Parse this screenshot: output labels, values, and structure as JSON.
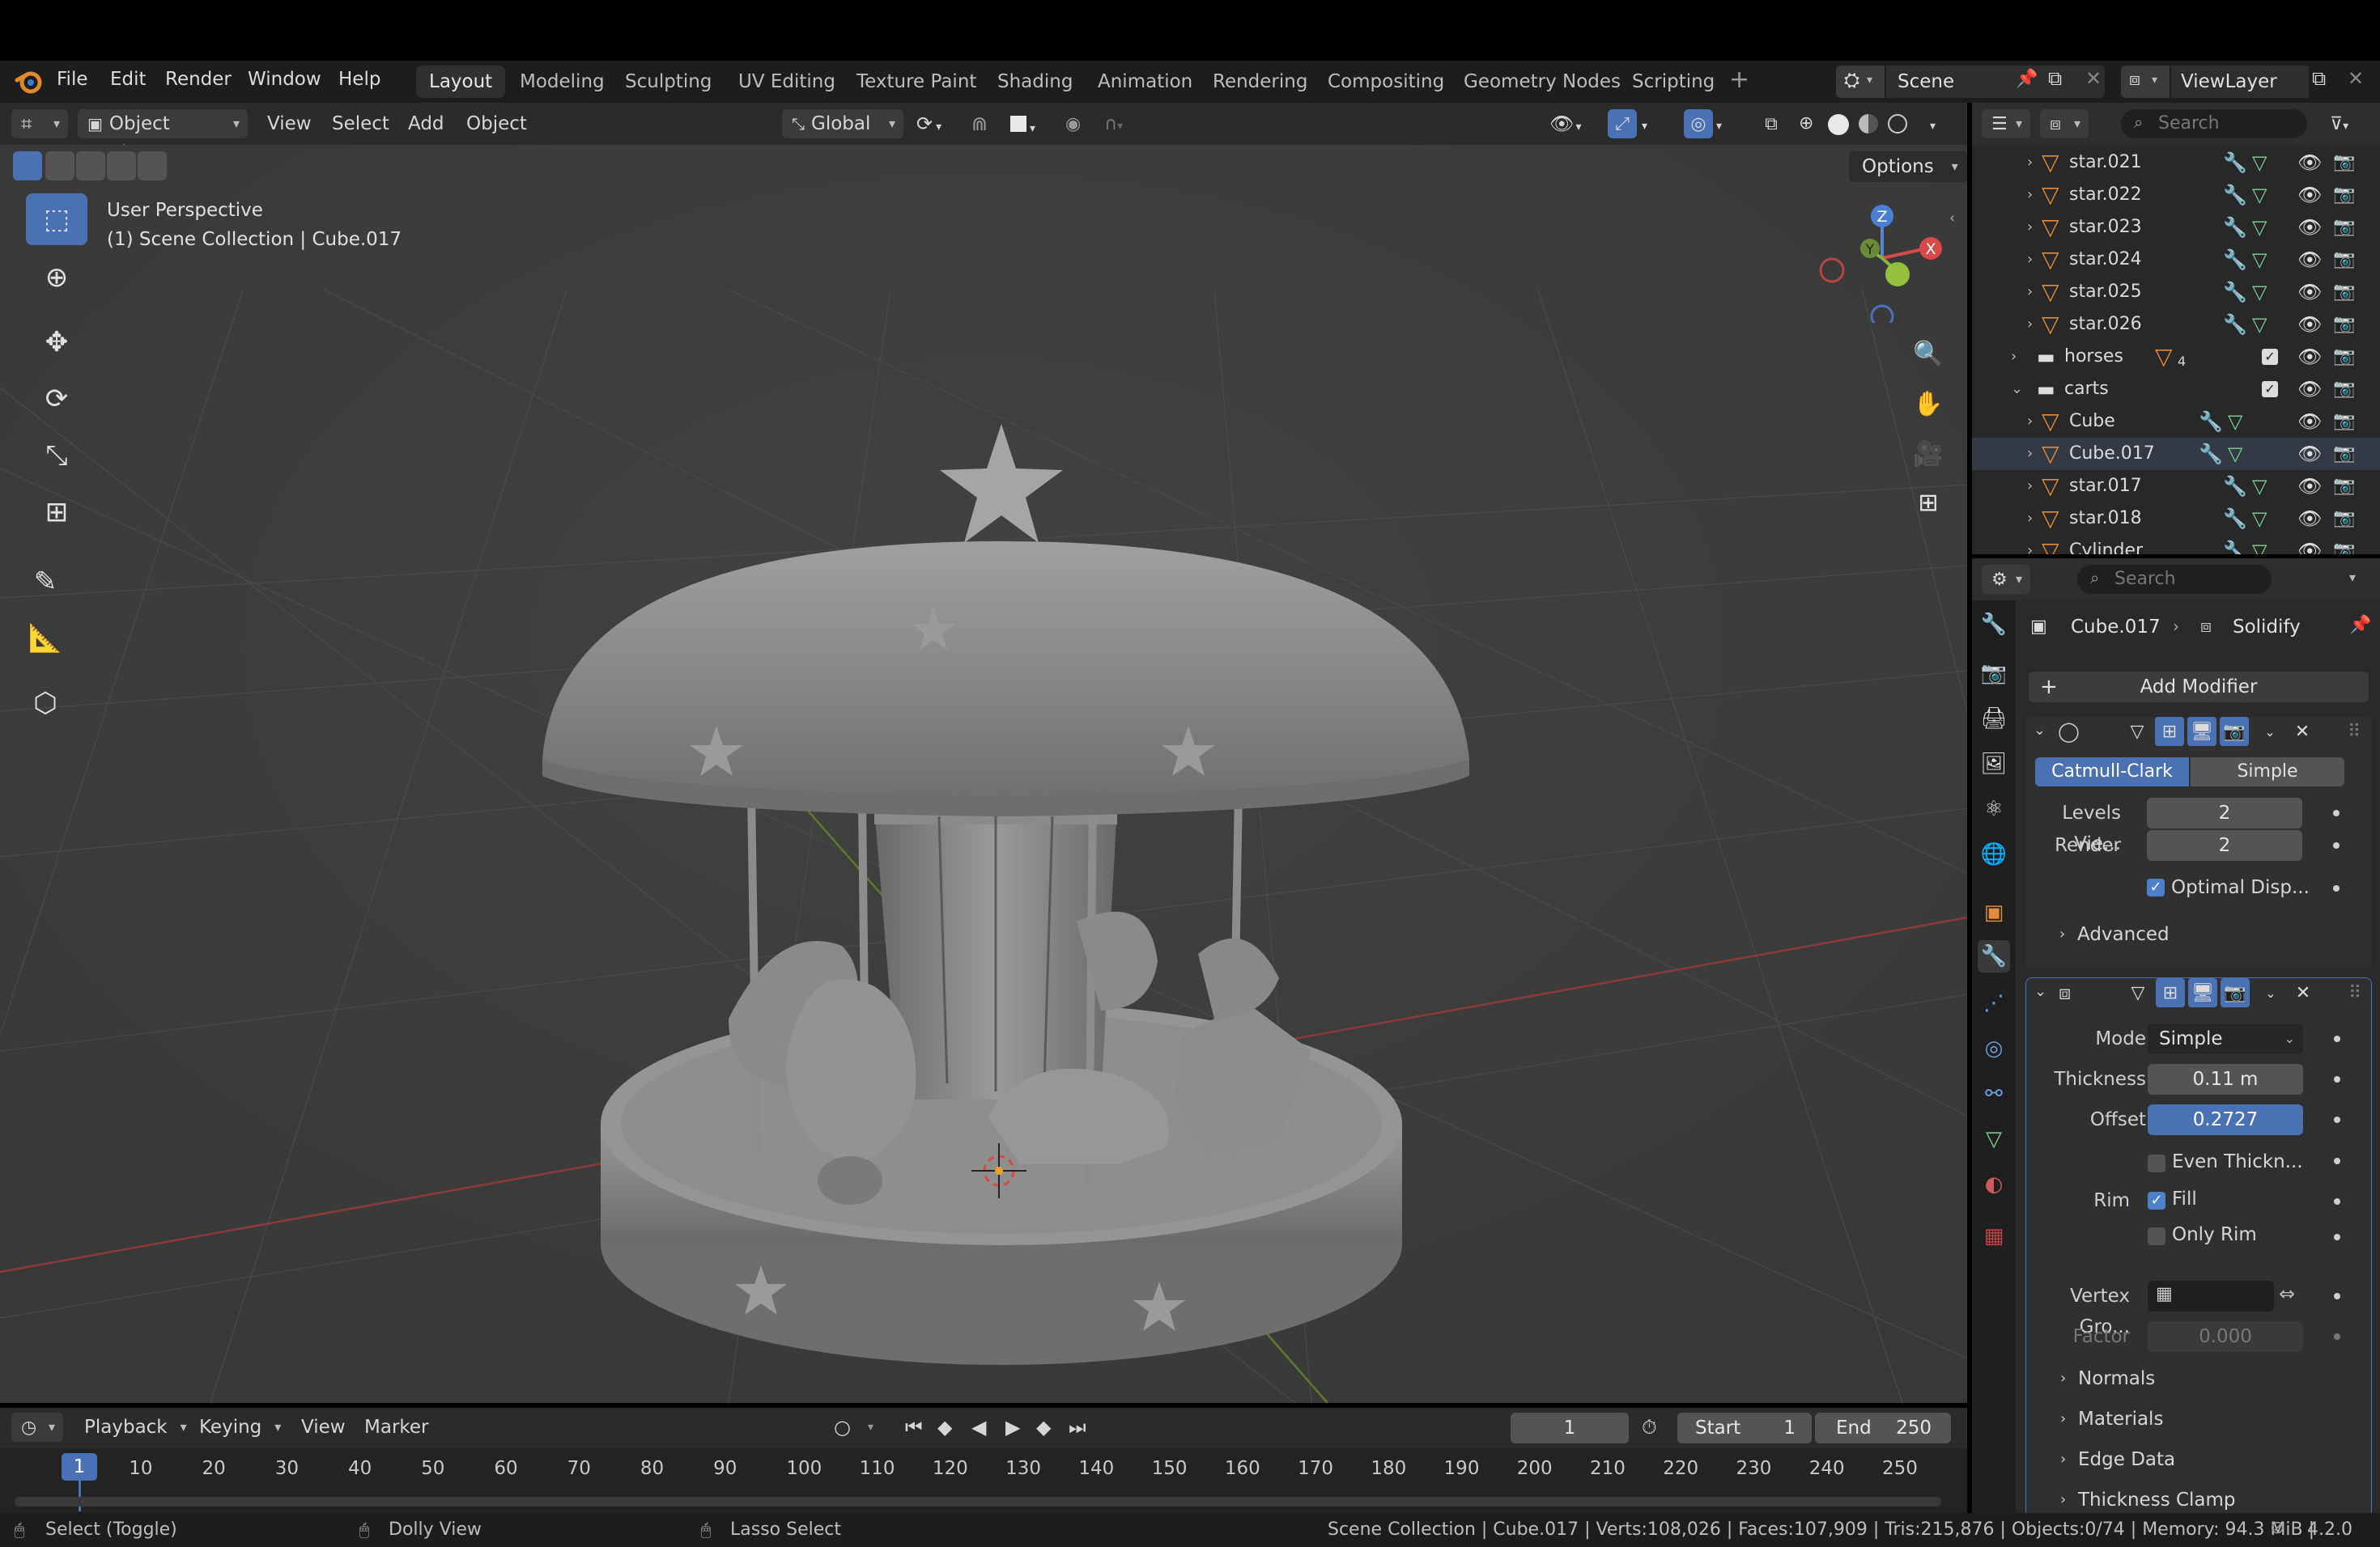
{
  "menu": {
    "file": "File",
    "edit": "Edit",
    "render": "Render",
    "window": "Window",
    "help": "Help"
  },
  "workspaces": [
    "Layout",
    "Modeling",
    "Sculpting",
    "UV Editing",
    "Texture Paint",
    "Shading",
    "Animation",
    "Rendering",
    "Compositing",
    "Geometry Nodes",
    "Scripting"
  ],
  "scene": {
    "name": "Scene",
    "viewlayer": "ViewLayer"
  },
  "viewport_header": {
    "mode": "Object Mode",
    "view": "View",
    "select": "Select",
    "add": "Add",
    "object": "Object",
    "orientation": "Global",
    "options": "Options"
  },
  "viewport": {
    "perspective": "User Perspective",
    "collection_info": "(1) Scene Collection | Cube.017",
    "gizmo": {
      "x": "X",
      "y": "Y",
      "z": "Z"
    }
  },
  "outliner": {
    "search_placeholder": "Search",
    "rows": [
      {
        "label": "star.021",
        "kind": "object"
      },
      {
        "label": "star.022",
        "kind": "object"
      },
      {
        "label": "star.023",
        "kind": "object"
      },
      {
        "label": "star.024",
        "kind": "object"
      },
      {
        "label": "star.025",
        "kind": "object"
      },
      {
        "label": "star.026",
        "kind": "object"
      },
      {
        "label": "horses",
        "kind": "collection",
        "count": "4"
      },
      {
        "label": "carts",
        "kind": "collection"
      },
      {
        "label": "Cube",
        "kind": "object"
      },
      {
        "label": "Cube.017",
        "kind": "object"
      },
      {
        "label": "star.017",
        "kind": "object"
      },
      {
        "label": "star.018",
        "kind": "object"
      },
      {
        "label": "Cylinder",
        "kind": "object"
      }
    ]
  },
  "properties": {
    "search_placeholder": "Search",
    "breadcrumb_object": "Cube.017",
    "breadcrumb_modifier": "Solidify",
    "add_modifier": "Add Modifier",
    "subsurf": {
      "catmull": "Catmull-Clark",
      "simple": "Simple",
      "levels_label": "Levels Vie...",
      "levels_value": "2",
      "render_label": "Render",
      "render_value": "2",
      "optimal": "Optimal Disp...",
      "advanced": "Advanced"
    },
    "solidify": {
      "mode_label": "Mode",
      "mode_value": "Simple",
      "thickness_label": "Thickness",
      "thickness_value": "0.11 m",
      "offset_label": "Offset",
      "offset_value": "0.2727",
      "even": "Even Thickn...",
      "rim_label": "Rim",
      "fill": "Fill",
      "only_rim": "Only Rim",
      "vgroup_label": "Vertex Gro...",
      "factor_label": "Factor",
      "factor_value": "0.000",
      "normals": "Normals",
      "materials": "Materials",
      "edge_data": "Edge Data",
      "thickness_clamp": "Thickness Clamp"
    }
  },
  "timeline": {
    "playback": "Playback",
    "keying": "Keying",
    "view": "View",
    "marker": "Marker",
    "current_frame": "1",
    "start_label": "Start",
    "start_value": "1",
    "end_label": "End",
    "end_value": "250",
    "ticks": [
      "1",
      "10",
      "20",
      "30",
      "40",
      "50",
      "60",
      "70",
      "80",
      "90",
      "100",
      "110",
      "120",
      "130",
      "140",
      "150",
      "160",
      "170",
      "180",
      "190",
      "200",
      "210",
      "220",
      "230",
      "240",
      "250"
    ]
  },
  "statusbar": {
    "select": "Select (Toggle)",
    "dolly": "Dolly View",
    "lasso": "Lasso Select",
    "stats": "Scene Collection | Cube.017 | Verts:108,026 | Faces:107,909 | Tris:215,876 | Objects:0/74 | Memory: 94.3 MiB | ",
    "version": "4.2.0"
  },
  "colors": {
    "accent": "#4a71b3",
    "object_icon": "#e48a3c",
    "modifier_icon": "#6a9ee0",
    "mesh_icon": "#7ed38b"
  }
}
